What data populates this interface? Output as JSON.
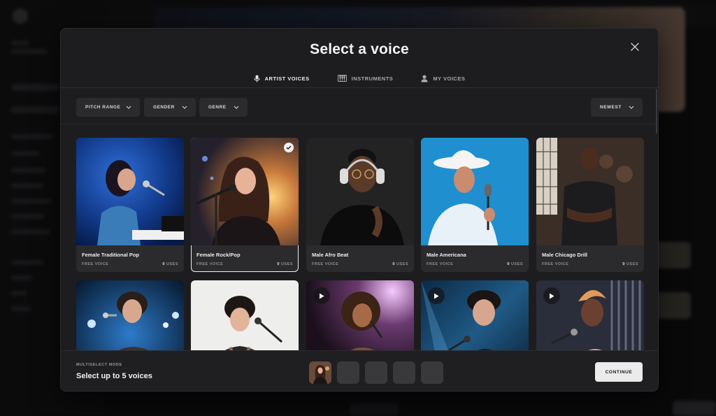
{
  "modal": {
    "title": "Select a voice"
  },
  "tabs": [
    {
      "label": "ARTIST VOICES",
      "icon": "microphone-icon",
      "active": true
    },
    {
      "label": "INSTRUMENTS",
      "icon": "piano-icon",
      "active": false
    },
    {
      "label": "MY VOICES",
      "icon": "user-icon",
      "active": false
    }
  ],
  "filters": {
    "pitch_range": "PITCH RANGE",
    "gender": "GENDER",
    "genre": "GENRE",
    "sort": "NEWEST"
  },
  "voices": [
    {
      "name": "Female Traditional Pop",
      "type": "FREE VOICE",
      "uses_count": "0",
      "uses_label": "USES",
      "selected": false
    },
    {
      "name": "Female Rock/Pop",
      "type": "FREE VOICE",
      "uses_count": "0",
      "uses_label": "USES",
      "selected": true
    },
    {
      "name": "Male Afro Beat",
      "type": "FREE VOICE",
      "uses_count": "0",
      "uses_label": "USES",
      "selected": false
    },
    {
      "name": "Male Americana",
      "type": "FREE VOICE",
      "uses_count": "0",
      "uses_label": "USES",
      "selected": false
    },
    {
      "name": "Male Chicago Drill",
      "type": "FREE VOICE",
      "uses_count": "0",
      "uses_label": "USES",
      "selected": false
    },
    {
      "name": "",
      "selected": false,
      "play_icon": false
    },
    {
      "name": "",
      "selected": false,
      "play_icon": false
    },
    {
      "name": "",
      "selected": false,
      "play_icon": true
    },
    {
      "name": "",
      "selected": false,
      "play_icon": true
    },
    {
      "name": "",
      "selected": false,
      "play_icon": true
    }
  ],
  "footer": {
    "mode_label": "MULTISELECT MODE",
    "instruction": "Select up to 5 voices",
    "selected_slots_filled": 1,
    "slot_count": 5,
    "continue_label": "CONTINUE"
  },
  "colors": {
    "modal_bg": "#1d1d1f",
    "card_bg": "#2b2b2e",
    "accent_button": "#ebebec"
  }
}
